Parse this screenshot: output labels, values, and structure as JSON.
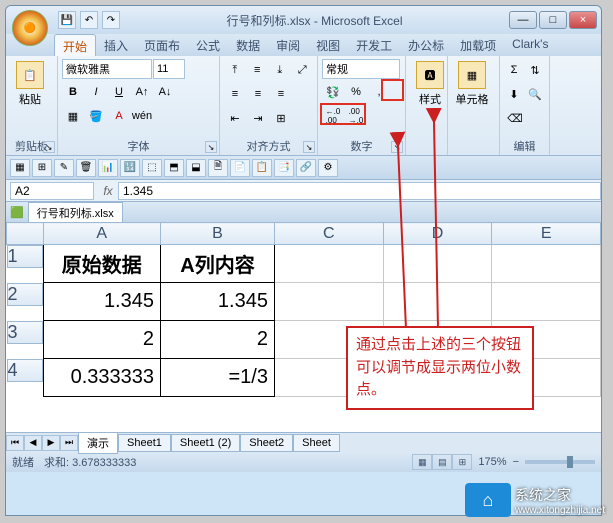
{
  "window": {
    "title": "行号和列标.xlsx - Microsoft Excel"
  },
  "qat": {
    "save": "💾",
    "undo": "↶",
    "redo": "↷"
  },
  "tabs": [
    "开始",
    "插入",
    "页面布",
    "公式",
    "数据",
    "审阅",
    "视图",
    "开发工",
    "办公标",
    "加载项",
    "Clark's"
  ],
  "ribbon": {
    "clipboard": {
      "label": "剪贴板",
      "paste": "粘贴"
    },
    "font": {
      "label": "字体",
      "name": "微软雅黑",
      "size": "11",
      "bold": "B",
      "italic": "I",
      "underline": "U"
    },
    "alignment": {
      "label": "对齐方式"
    },
    "number": {
      "label": "数字",
      "format": "常规",
      "percent": "%",
      "comma": ",",
      "currency": "💱",
      "inc": ".00→.0",
      "dec": ".0→.00"
    },
    "styles": {
      "label": "样式",
      "btn": "样式"
    },
    "cells": {
      "label": "单元格",
      "btn": "单元格"
    },
    "editing": {
      "label": "编辑"
    }
  },
  "formula_bar": {
    "namebox": "A2",
    "fx": "fx",
    "formula": "1.345"
  },
  "workbook_tab": "行号和列标.xlsx",
  "grid": {
    "cols": [
      "A",
      "B",
      "C",
      "D",
      "E"
    ],
    "rows": [
      "1",
      "2",
      "3",
      "4"
    ],
    "cells": {
      "A1": "原始数据",
      "B1": "A列内容",
      "A2": "1.345",
      "B2": "1.345",
      "A3": "2",
      "B3": "2",
      "A4": "0.333333",
      "B4": "=1/3"
    }
  },
  "annotation": "通过点击上述的三个按钮可以调节成显示两位小数点。",
  "sheet_tabs": [
    "演示",
    "Sheet1",
    "Sheet1 (2)",
    "Sheet2",
    "Sheet"
  ],
  "statusbar": {
    "ready": "就绪",
    "calc": "求和: 3.678333333",
    "zoom": "175%"
  },
  "winbtns": {
    "min": "—",
    "max": "□",
    "close": "×"
  },
  "watermark": {
    "name": "系统之家",
    "url": "www.xitongzhijia.net"
  }
}
